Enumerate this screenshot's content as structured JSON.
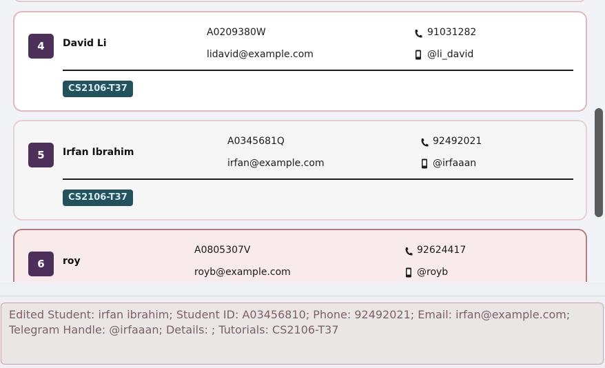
{
  "students": [
    {
      "index": "4",
      "name": "David Li",
      "student_id": "A0209380W",
      "email": "lidavid@example.com",
      "phone": "91031282",
      "telegram": "@li_david",
      "tutorial": "CS2106-T37"
    },
    {
      "index": "5",
      "name": "Irfan Ibrahim",
      "student_id": "A0345681Q",
      "email": "irfan@example.com",
      "phone": "92492021",
      "telegram": "@irfaaan",
      "tutorial": "CS2106-T37"
    },
    {
      "index": "6",
      "name": "roy",
      "student_id": "A0805307V",
      "email": "royb@example.com",
      "phone": "92624417",
      "telegram": "@royb"
    }
  ],
  "result_display": {
    "text": "Edited Student: irfan ibrahim; Student ID: A03456810; Phone: 92492021; Email: irfan@example.com; Telegram Handle: @irfaaan; Details: ; Tutorials: CS2106-T37"
  },
  "icons": {
    "phone": "phone-icon",
    "telegram": "mobile-icon"
  },
  "colors": {
    "index_badge": "#4c3059",
    "tag_bg": "#24525c",
    "selected_card": "#f9eaeb"
  }
}
